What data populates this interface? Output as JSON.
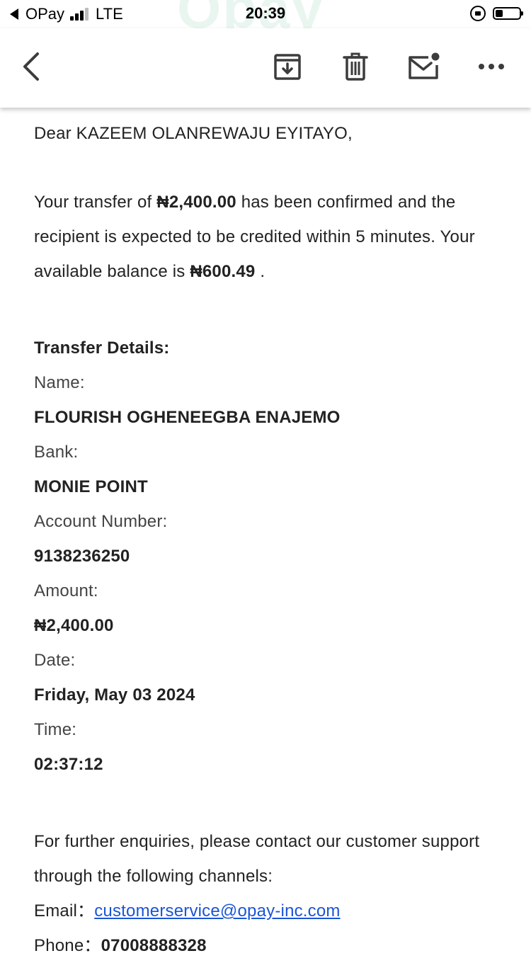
{
  "status_bar": {
    "carrier": "OPay",
    "network": "LTE",
    "time": "20:39",
    "battery_level": 0.3
  },
  "toolbar": {
    "back_icon": "chevron-left-icon",
    "archive_icon": "archive-icon",
    "trash_icon": "trash-icon",
    "mail_icon": "mail-unread-icon",
    "more_icon": "more-horizontal-icon"
  },
  "email": {
    "greeting": "Dear KAZEEM OLANREWAJU EYITAYO,",
    "intro": {
      "part1": "Your transfer of ",
      "amount": "₦2,400.00",
      "part2": " has been confirmed and the recipient is expected to be credited within 5 minutes. Your available balance is ",
      "balance": "₦600.49",
      "part3": " ."
    },
    "details_title": "Transfer Details:",
    "details": [
      {
        "label": "Name:",
        "value": "FLOURISH OGHENEEGBA ENAJEMO"
      },
      {
        "label": "Bank:",
        "value": "MONIE POINT"
      },
      {
        "label": "Account Number:",
        "value": "9138236250"
      },
      {
        "label": "Amount:",
        "value": "₦2,400.00"
      },
      {
        "label": "Date:",
        "value": "Friday, May 03 2024"
      },
      {
        "label": "Time:",
        "value": "02:37:12"
      }
    ],
    "enquiry": "For further enquiries, please contact our customer support through the following channels:",
    "email_label": "Email：",
    "email_address": "customerservice@opay-inc.com",
    "phone_label": "Phone：",
    "phone_number": "07008888328"
  },
  "colors": {
    "link": "#1a55d6",
    "text": "#222222",
    "watermark": "#e9f6ef"
  }
}
